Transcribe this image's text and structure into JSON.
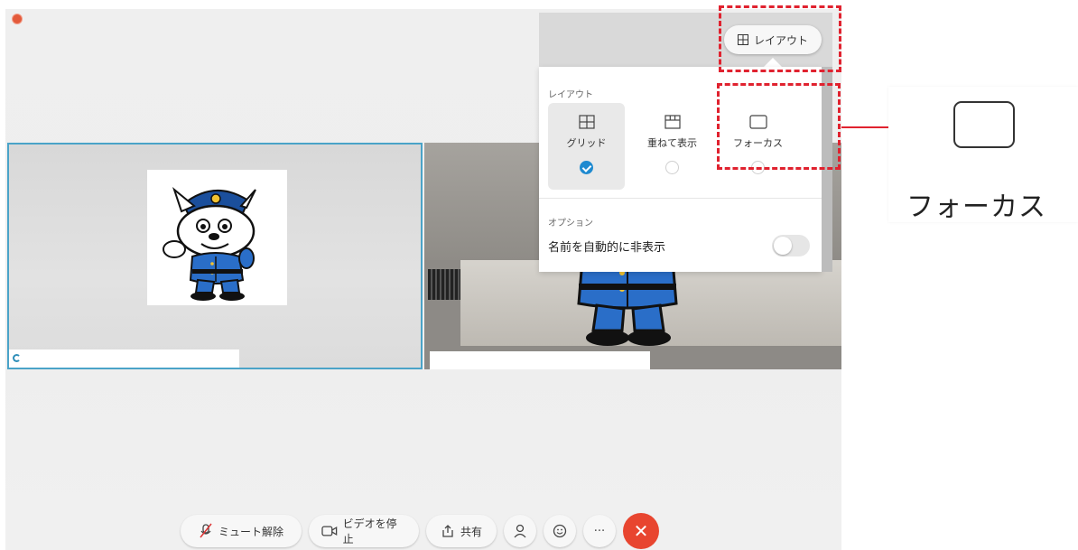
{
  "header": {
    "layout_button_label": "レイアウト"
  },
  "popover": {
    "section_layout_label": "レイアウト",
    "options": [
      {
        "label": "グリッド",
        "icon": "grid-icon",
        "selected": true
      },
      {
        "label": "重ねて表示",
        "icon": "stack-icon",
        "selected": false
      },
      {
        "label": "フォーカス",
        "icon": "focus-icon",
        "selected": false
      }
    ],
    "section_options_label": "オプション",
    "auto_hide_names_label": "名前を自動的に非表示",
    "auto_hide_names_on": false
  },
  "callout": {
    "label": "フォーカス",
    "icon": "focus-icon"
  },
  "toolbar": {
    "unmute_label": "ミュート解除",
    "stop_video_label": "ビデオを停止",
    "share_label": "共有",
    "more_label": "···"
  },
  "colors": {
    "highlight": "#e0222f",
    "accent": "#1f8ad0",
    "end_call": "#e8452f",
    "selected_tile_border": "#4aa3c8"
  }
}
